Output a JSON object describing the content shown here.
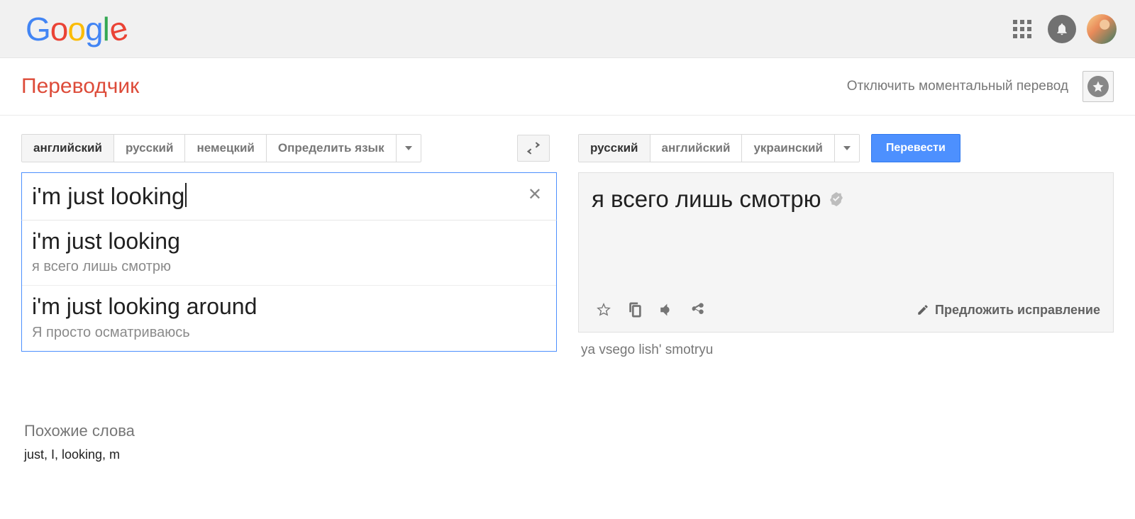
{
  "app": {
    "title": "Переводчик"
  },
  "header": {
    "instant_off": "Отключить моментальный перевод"
  },
  "source": {
    "tabs": [
      "английский",
      "русский",
      "немецкий",
      "Определить язык"
    ],
    "active_index": 0,
    "input_text": "i'm just looking",
    "suggestions": [
      {
        "text": "i'm just looking",
        "translation": "я всего лишь смотрю"
      },
      {
        "text": "i'm just looking around",
        "translation": "Я просто осматриваюсь"
      }
    ]
  },
  "target": {
    "tabs": [
      "русский",
      "английский",
      "украинский"
    ],
    "active_index": 0,
    "translate_button": "Перевести",
    "output_text": "я всего лишь смотрю",
    "transliteration": "ya vsego lish' smotryu",
    "suggest_edit": "Предложить исправление"
  },
  "related": {
    "heading": "Похожие слова",
    "words": "just, I, looking, m"
  }
}
